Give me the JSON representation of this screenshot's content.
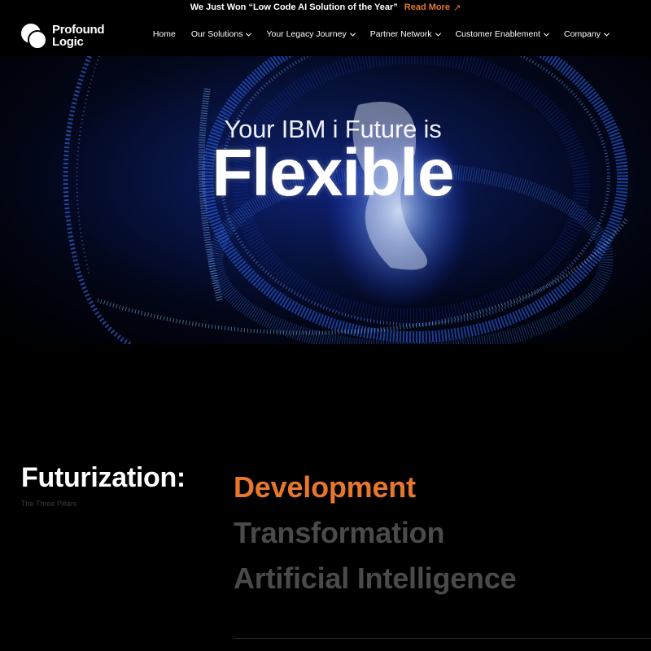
{
  "announcement": {
    "text": "We Just Won “Low Code AI Solution of the Year”",
    "link_label": "Read More",
    "link_icon": "arrow-up-right-icon"
  },
  "logo": {
    "line1": "Profound",
    "line2": "Logic"
  },
  "nav": [
    {
      "label": "Home",
      "has_dropdown": false
    },
    {
      "label": "Our Solutions",
      "has_dropdown": true
    },
    {
      "label": "Your Legacy Journey",
      "has_dropdown": true
    },
    {
      "label": "Partner Network",
      "has_dropdown": true
    },
    {
      "label": "Customer Enablement",
      "has_dropdown": true
    },
    {
      "label": "Company",
      "has_dropdown": true
    }
  ],
  "hero": {
    "subtitle": "Your IBM i Future is",
    "title": "Flexible"
  },
  "pillars": {
    "title": "Futurization:",
    "subtitle": "The Three Pillars",
    "items": [
      "Development",
      "Transformation",
      "Artificial Intelligence"
    ],
    "active_index": 0
  },
  "colors": {
    "accent": "#e8772e",
    "background": "#000000",
    "inactive_text": "#4a4a4a",
    "hero_glow": "#2a6bff"
  }
}
